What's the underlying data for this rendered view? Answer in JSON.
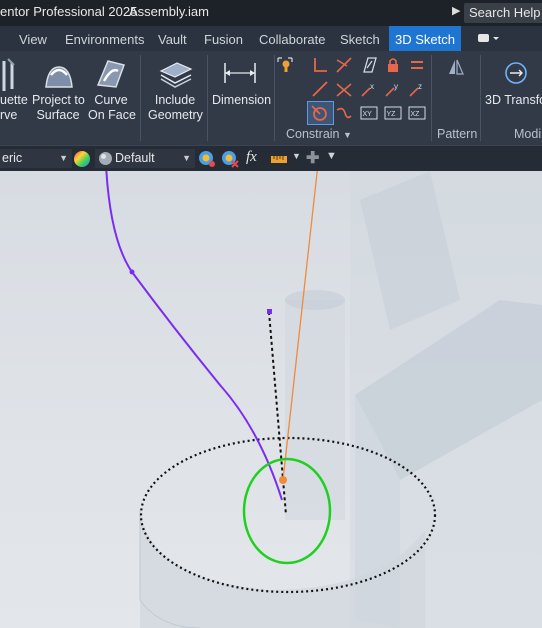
{
  "titlebar": {
    "app_title": "entor Professional 2025",
    "file_name": "Assembly.iam",
    "search_placeholder": "Search Help &"
  },
  "tabs": [
    {
      "label": "View"
    },
    {
      "label": "Environments"
    },
    {
      "label": "Vault"
    },
    {
      "label": "Fusion"
    },
    {
      "label": "Collaborate"
    },
    {
      "label": "Sketch"
    },
    {
      "label": "3D Sketch",
      "active": true
    }
  ],
  "ribbon": {
    "silhouette": {
      "line1": "uette",
      "line2": "rve"
    },
    "project_to_surface": {
      "line1": "Project to",
      "line2": "Surface"
    },
    "curve_on_face": {
      "line1": "Curve",
      "line2": "On Face"
    },
    "include_geometry": {
      "line1": "Include",
      "line2": "Geometry"
    },
    "dimension": {
      "label": "Dimension"
    },
    "transform": {
      "label": "3D Transfor"
    },
    "panels": {
      "constrain": "Constrain",
      "pattern": "Pattern",
      "modify": "Modi"
    }
  },
  "propbar": {
    "style_value": "eric",
    "appearance_value": "Default",
    "fx_label": "fx"
  },
  "colors": {
    "accent": "#1f76d2",
    "curve": "#7a2df0",
    "circle": "#1fd01f",
    "orange_line": "#f08a3c"
  }
}
